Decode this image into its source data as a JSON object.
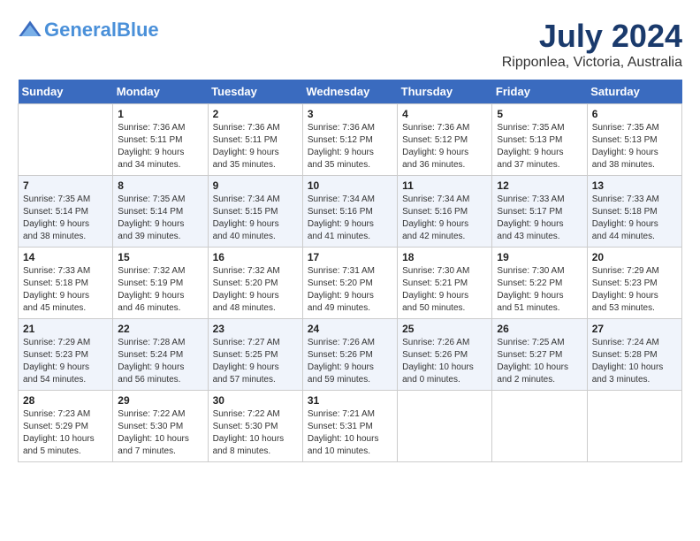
{
  "header": {
    "logo_line1": "General",
    "logo_line2": "Blue",
    "month_year": "July 2024",
    "location": "Ripponlea, Victoria, Australia"
  },
  "weekdays": [
    "Sunday",
    "Monday",
    "Tuesday",
    "Wednesday",
    "Thursday",
    "Friday",
    "Saturday"
  ],
  "weeks": [
    [
      {
        "day": "",
        "info": ""
      },
      {
        "day": "1",
        "info": "Sunrise: 7:36 AM\nSunset: 5:11 PM\nDaylight: 9 hours\nand 34 minutes."
      },
      {
        "day": "2",
        "info": "Sunrise: 7:36 AM\nSunset: 5:11 PM\nDaylight: 9 hours\nand 35 minutes."
      },
      {
        "day": "3",
        "info": "Sunrise: 7:36 AM\nSunset: 5:12 PM\nDaylight: 9 hours\nand 35 minutes."
      },
      {
        "day": "4",
        "info": "Sunrise: 7:36 AM\nSunset: 5:12 PM\nDaylight: 9 hours\nand 36 minutes."
      },
      {
        "day": "5",
        "info": "Sunrise: 7:35 AM\nSunset: 5:13 PM\nDaylight: 9 hours\nand 37 minutes."
      },
      {
        "day": "6",
        "info": "Sunrise: 7:35 AM\nSunset: 5:13 PM\nDaylight: 9 hours\nand 38 minutes."
      }
    ],
    [
      {
        "day": "7",
        "info": "Sunrise: 7:35 AM\nSunset: 5:14 PM\nDaylight: 9 hours\nand 38 minutes."
      },
      {
        "day": "8",
        "info": "Sunrise: 7:35 AM\nSunset: 5:14 PM\nDaylight: 9 hours\nand 39 minutes."
      },
      {
        "day": "9",
        "info": "Sunrise: 7:34 AM\nSunset: 5:15 PM\nDaylight: 9 hours\nand 40 minutes."
      },
      {
        "day": "10",
        "info": "Sunrise: 7:34 AM\nSunset: 5:16 PM\nDaylight: 9 hours\nand 41 minutes."
      },
      {
        "day": "11",
        "info": "Sunrise: 7:34 AM\nSunset: 5:16 PM\nDaylight: 9 hours\nand 42 minutes."
      },
      {
        "day": "12",
        "info": "Sunrise: 7:33 AM\nSunset: 5:17 PM\nDaylight: 9 hours\nand 43 minutes."
      },
      {
        "day": "13",
        "info": "Sunrise: 7:33 AM\nSunset: 5:18 PM\nDaylight: 9 hours\nand 44 minutes."
      }
    ],
    [
      {
        "day": "14",
        "info": "Sunrise: 7:33 AM\nSunset: 5:18 PM\nDaylight: 9 hours\nand 45 minutes."
      },
      {
        "day": "15",
        "info": "Sunrise: 7:32 AM\nSunset: 5:19 PM\nDaylight: 9 hours\nand 46 minutes."
      },
      {
        "day": "16",
        "info": "Sunrise: 7:32 AM\nSunset: 5:20 PM\nDaylight: 9 hours\nand 48 minutes."
      },
      {
        "day": "17",
        "info": "Sunrise: 7:31 AM\nSunset: 5:20 PM\nDaylight: 9 hours\nand 49 minutes."
      },
      {
        "day": "18",
        "info": "Sunrise: 7:30 AM\nSunset: 5:21 PM\nDaylight: 9 hours\nand 50 minutes."
      },
      {
        "day": "19",
        "info": "Sunrise: 7:30 AM\nSunset: 5:22 PM\nDaylight: 9 hours\nand 51 minutes."
      },
      {
        "day": "20",
        "info": "Sunrise: 7:29 AM\nSunset: 5:23 PM\nDaylight: 9 hours\nand 53 minutes."
      }
    ],
    [
      {
        "day": "21",
        "info": "Sunrise: 7:29 AM\nSunset: 5:23 PM\nDaylight: 9 hours\nand 54 minutes."
      },
      {
        "day": "22",
        "info": "Sunrise: 7:28 AM\nSunset: 5:24 PM\nDaylight: 9 hours\nand 56 minutes."
      },
      {
        "day": "23",
        "info": "Sunrise: 7:27 AM\nSunset: 5:25 PM\nDaylight: 9 hours\nand 57 minutes."
      },
      {
        "day": "24",
        "info": "Sunrise: 7:26 AM\nSunset: 5:26 PM\nDaylight: 9 hours\nand 59 minutes."
      },
      {
        "day": "25",
        "info": "Sunrise: 7:26 AM\nSunset: 5:26 PM\nDaylight: 10 hours\nand 0 minutes."
      },
      {
        "day": "26",
        "info": "Sunrise: 7:25 AM\nSunset: 5:27 PM\nDaylight: 10 hours\nand 2 minutes."
      },
      {
        "day": "27",
        "info": "Sunrise: 7:24 AM\nSunset: 5:28 PM\nDaylight: 10 hours\nand 3 minutes."
      }
    ],
    [
      {
        "day": "28",
        "info": "Sunrise: 7:23 AM\nSunset: 5:29 PM\nDaylight: 10 hours\nand 5 minutes."
      },
      {
        "day": "29",
        "info": "Sunrise: 7:22 AM\nSunset: 5:30 PM\nDaylight: 10 hours\nand 7 minutes."
      },
      {
        "day": "30",
        "info": "Sunrise: 7:22 AM\nSunset: 5:30 PM\nDaylight: 10 hours\nand 8 minutes."
      },
      {
        "day": "31",
        "info": "Sunrise: 7:21 AM\nSunset: 5:31 PM\nDaylight: 10 hours\nand 10 minutes."
      },
      {
        "day": "",
        "info": ""
      },
      {
        "day": "",
        "info": ""
      },
      {
        "day": "",
        "info": ""
      }
    ]
  ]
}
